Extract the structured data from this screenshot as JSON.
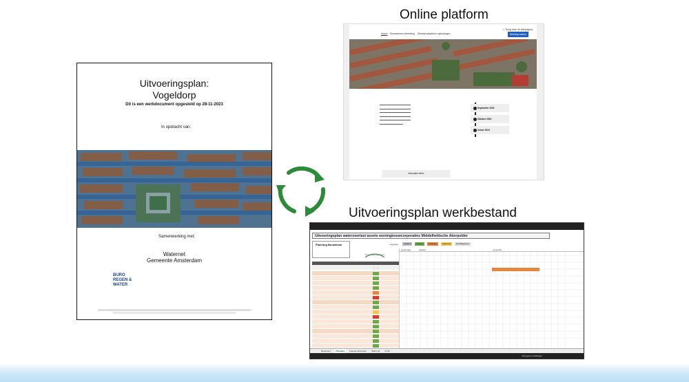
{
  "captions": {
    "online": "Online platform",
    "werkbestand": "Uitvoeringsplan werkbestand"
  },
  "document": {
    "title_line1": "Uitvoeringsplan:",
    "title_line2": "Vogeldorp",
    "subtitle": "Dit is een werkdocument opgesteld op 28-11-2023",
    "opdracht": "In opdracht van:",
    "samenwerking": "Samenwerking met:",
    "partner1": "Waternet",
    "partner2": "Gemeente Amsterdam",
    "logo_line1": "BURO",
    "logo_line2": "REGEN & WATER"
  },
  "website": {
    "back_link": "< Terug naar de startpagina",
    "nav": [
      "Home",
      "Bouwstenen-inbedding",
      "Klimaat adaptieve oplossingen"
    ],
    "cta_button": "Meeting maken",
    "timeline": [
      "September 2023",
      "Oktober 2023",
      "Zomer 2024"
    ],
    "info_button": "Informatie delen"
  },
  "spreadsheet": {
    "title": "Uitvoeringsplan wateroverlast assets woningbouwcorporaties Middelheldsche Akerpolder",
    "planning_title": "Planning Bouwteam",
    "legend_label": "Legenda",
    "legend": [
      {
        "label": "Gepland",
        "color": "#bdbdbd"
      },
      {
        "label": "Gereed",
        "color": "#6aaa4a"
      },
      {
        "label": "Vertraagd",
        "color": "#e8843e"
      },
      {
        "label": "Uitgesteld",
        "color": "#f3c64a"
      },
      {
        "label": "Niet Begonnen",
        "color": "#d9d9d9"
      }
    ],
    "logo_text": "Vereniging Vogeldorp",
    "months": [
      "september",
      "oktober",
      "november"
    ],
    "tabs": [
      "Bestanden",
      "Planning",
      "Faseda Aktiviteiten",
      "Blad3 (2)",
      "Ch10"
    ],
    "active_tab": "Planning",
    "status": "Weergave-instellingen"
  }
}
